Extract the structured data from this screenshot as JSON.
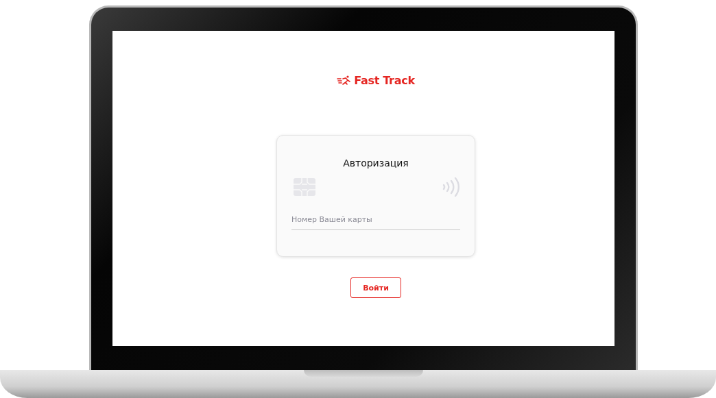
{
  "logo": {
    "text": "Fast Track"
  },
  "login_card": {
    "title": "Авторизация",
    "card_number_field": {
      "placeholder": "Номер Вашей карты"
    }
  },
  "buttons": [
    {
      "label": "Войти",
      "kind": "outline"
    }
  ]
}
